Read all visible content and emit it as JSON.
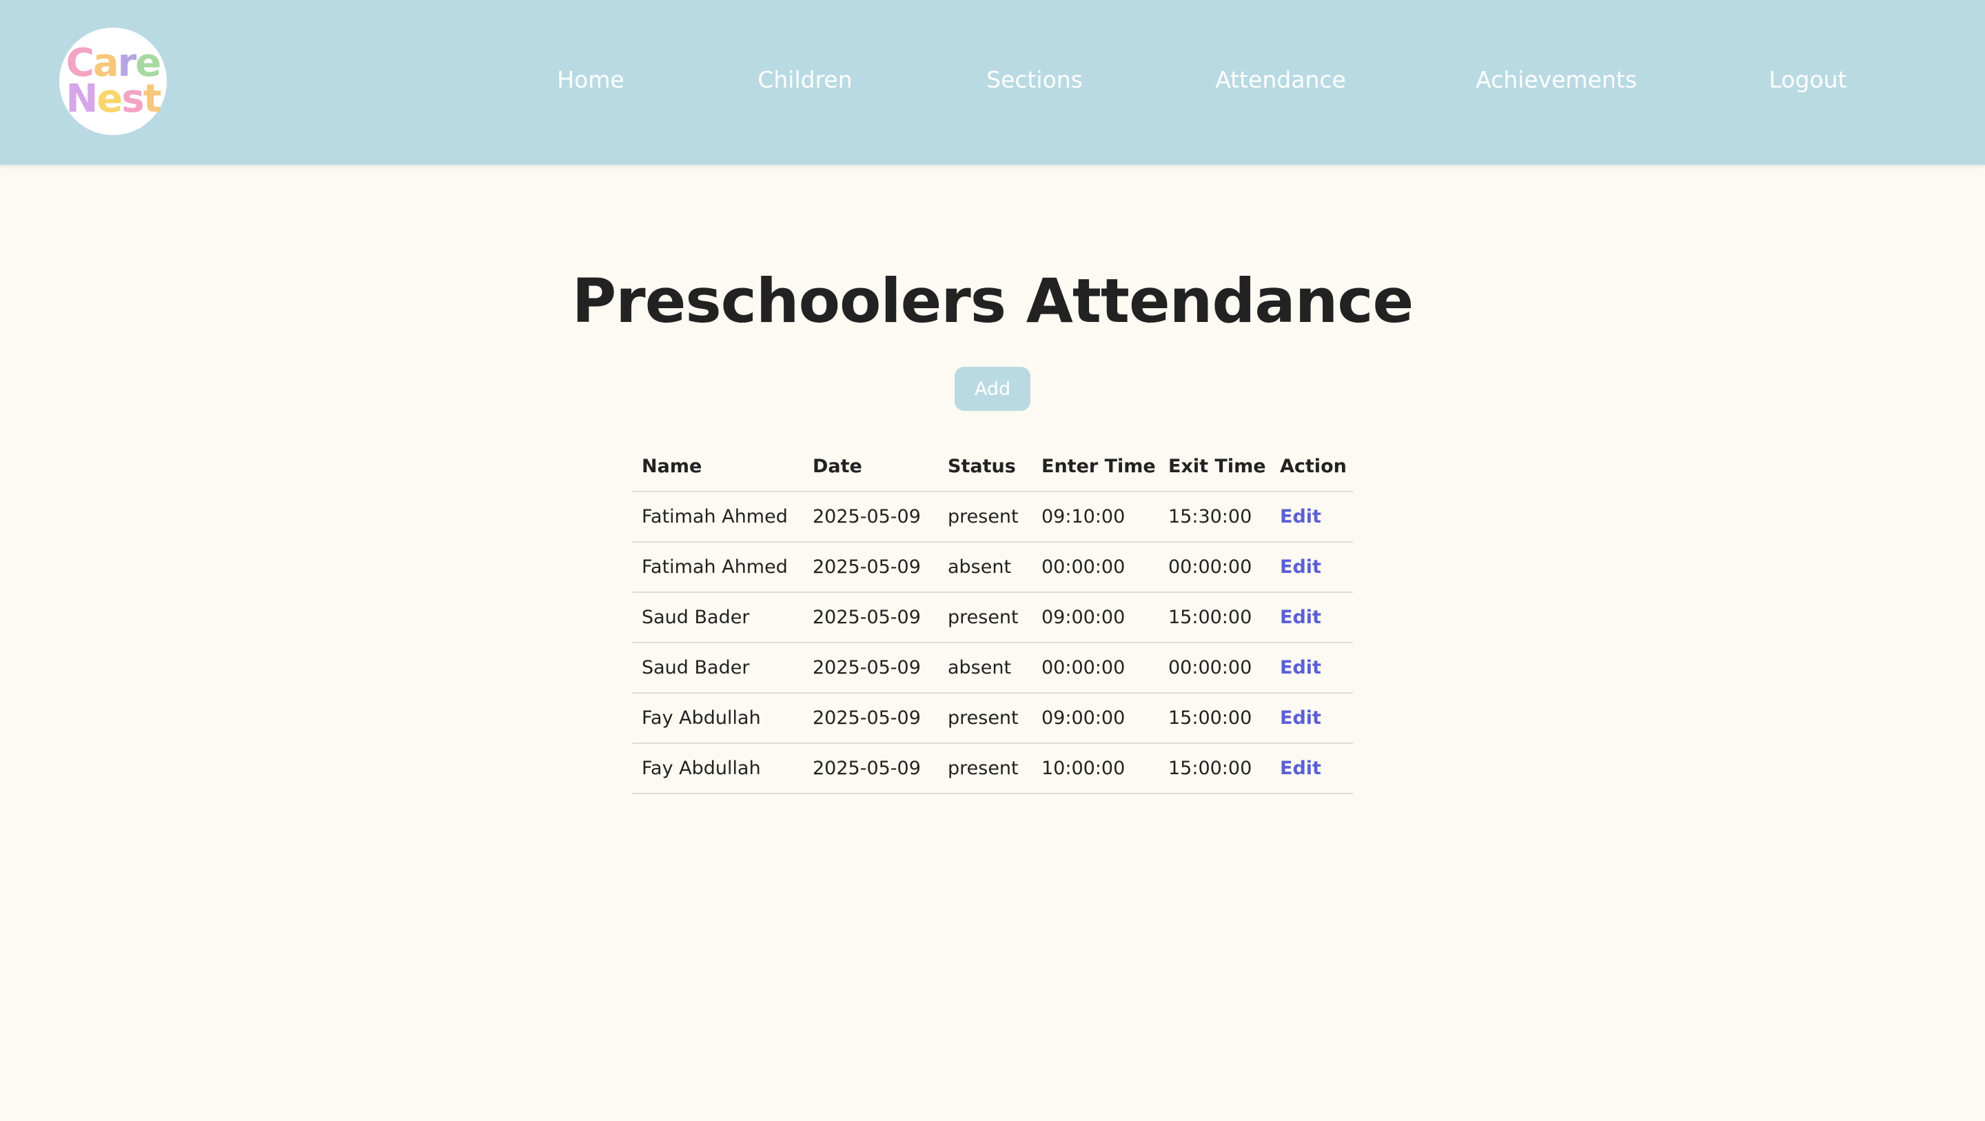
{
  "brand": {
    "logo_line1": [
      "C",
      "a",
      "r",
      "e"
    ],
    "logo_line2": [
      "N",
      "e",
      "s",
      "t"
    ],
    "logo_line1_colors": [
      "#f3a3c4",
      "#f7c77b",
      "#b7a4e3",
      "#a6d9a1"
    ],
    "logo_line2_colors": [
      "#d6a6e8",
      "#f7d66b",
      "#f3a3c4",
      "#f7c77b"
    ]
  },
  "nav": {
    "home": "Home",
    "children": "Children",
    "sections": "Sections",
    "attendance": "Attendance",
    "achievements": "Achievements",
    "logout": "Logout"
  },
  "page": {
    "title": "Preschoolers Attendance",
    "add_label": "Add"
  },
  "table": {
    "headers": {
      "name": "Name",
      "date": "Date",
      "status": "Status",
      "enter_time": "Enter Time",
      "exit_time": "Exit Time",
      "action": "Action"
    },
    "rows": [
      {
        "name": "Fatimah Ahmed",
        "date": "2025-05-09",
        "status": "present",
        "enter_time": "09:10:00",
        "exit_time": "15:30:00",
        "action": "Edit"
      },
      {
        "name": "Fatimah Ahmed",
        "date": "2025-05-09",
        "status": "absent",
        "enter_time": "00:00:00",
        "exit_time": "00:00:00",
        "action": "Edit"
      },
      {
        "name": "Saud Bader",
        "date": "2025-05-09",
        "status": "present",
        "enter_time": "09:00:00",
        "exit_time": "15:00:00",
        "action": "Edit"
      },
      {
        "name": "Saud Bader",
        "date": "2025-05-09",
        "status": "absent",
        "enter_time": "00:00:00",
        "exit_time": "00:00:00",
        "action": "Edit"
      },
      {
        "name": "Fay Abdullah",
        "date": "2025-05-09",
        "status": "present",
        "enter_time": "09:00:00",
        "exit_time": "15:00:00",
        "action": "Edit"
      },
      {
        "name": "Fay Abdullah",
        "date": "2025-05-09",
        "status": "present",
        "enter_time": "10:00:00",
        "exit_time": "15:00:00",
        "action": "Edit"
      }
    ]
  },
  "colors": {
    "header_bg": "#b9dae2",
    "page_bg": "#fcfaf2",
    "link": "#5b5fd6",
    "text": "#222222"
  }
}
